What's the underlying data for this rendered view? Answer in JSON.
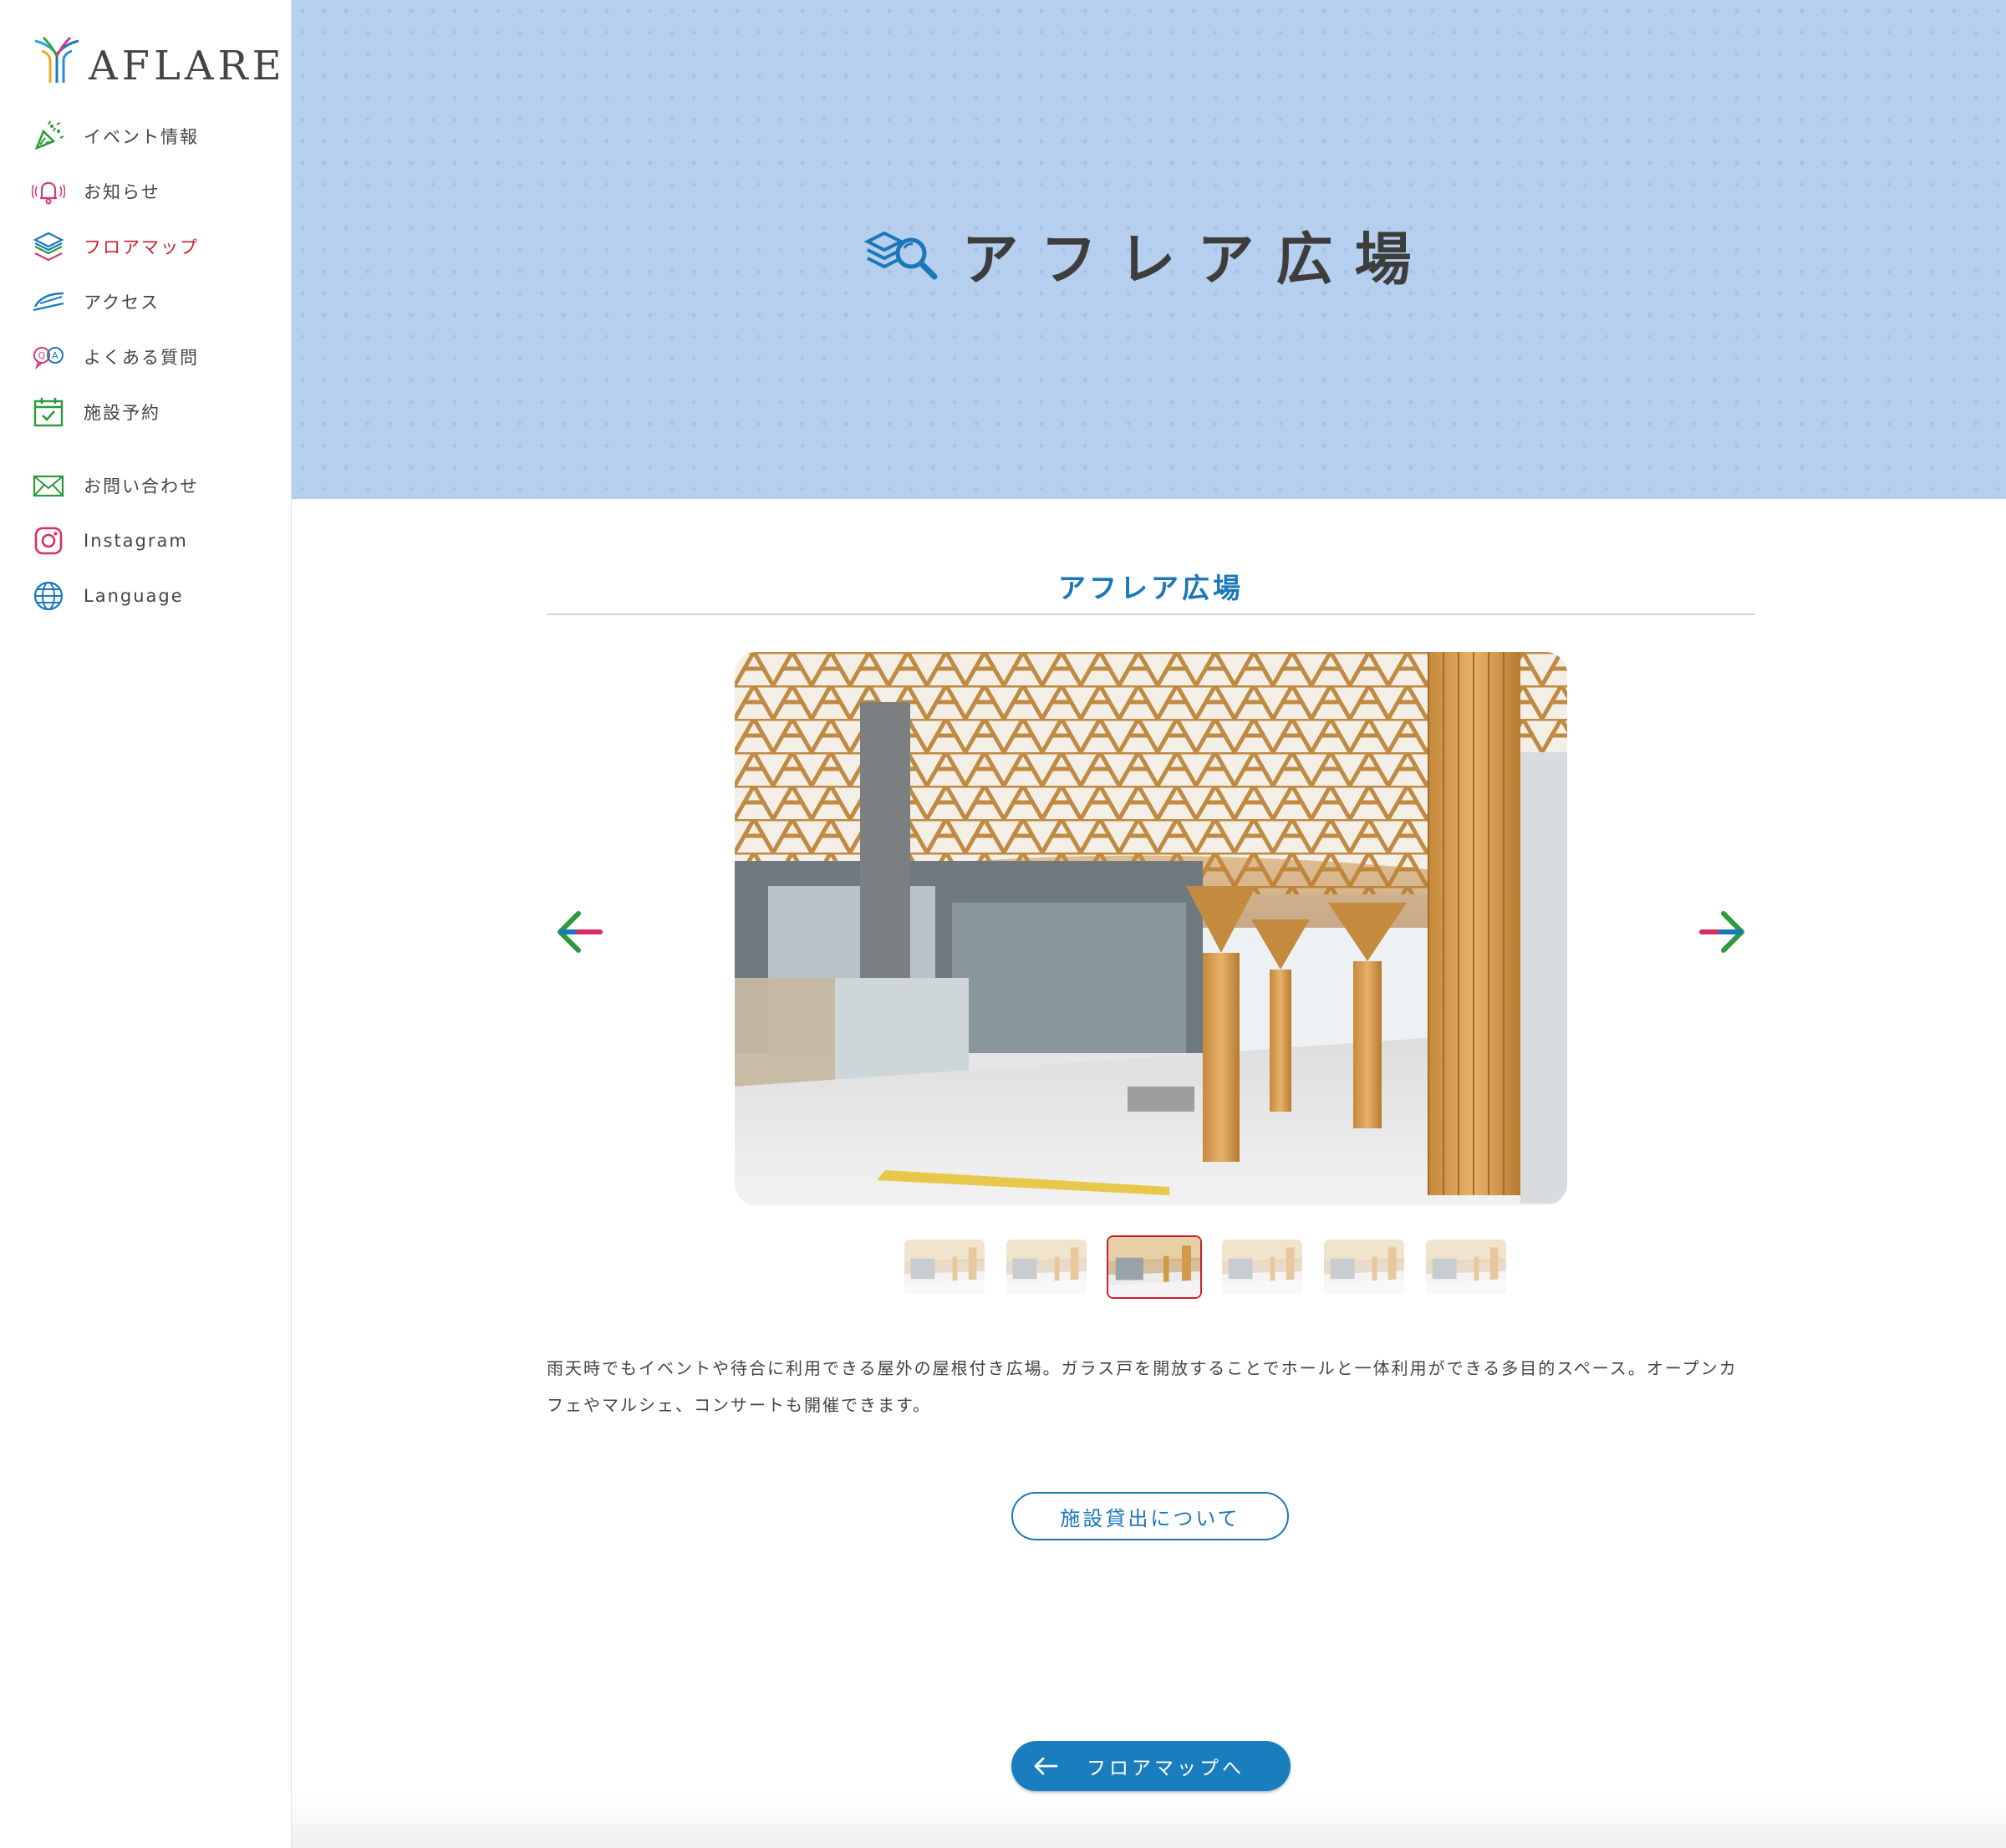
{
  "brand": {
    "logo_text": "AFLARE"
  },
  "sidebar": {
    "items": [
      {
        "label": "イベント情報",
        "icon": "party-popper-icon"
      },
      {
        "label": "お知らせ",
        "icon": "bell-icon"
      },
      {
        "label": "フロアマップ",
        "icon": "layers-icon",
        "active": true
      },
      {
        "label": "アクセス",
        "icon": "train-icon"
      },
      {
        "label": "よくある質問",
        "icon": "qa-icon"
      },
      {
        "label": "施設予約",
        "icon": "calendar-check-icon"
      }
    ],
    "links": [
      {
        "label": "お問い合わせ",
        "icon": "mail-icon"
      },
      {
        "label": "Instagram",
        "icon": "instagram-icon"
      },
      {
        "label": "Language",
        "icon": "globe-icon"
      }
    ]
  },
  "hero": {
    "title": "アフレア広場",
    "icon": "layers-search-icon"
  },
  "main": {
    "section_title": "アフレア広場",
    "carousel": {
      "thumbnail_count": 6,
      "active_index": 2
    },
    "description": "雨天時でもイベントや待合に利用できる屋外の屋根付き広場。ガラス戸を開放することでホールと一体利用ができる多目的スペース。オープンカフェやマルシェ、コンサートも開催できます。",
    "rental_button": "施設貸出について",
    "back_button": "フロアマップへ"
  },
  "colors": {
    "accent_blue": "#1a78b9",
    "active_red": "#c8202f",
    "hero_bg": "#b6cfee"
  }
}
